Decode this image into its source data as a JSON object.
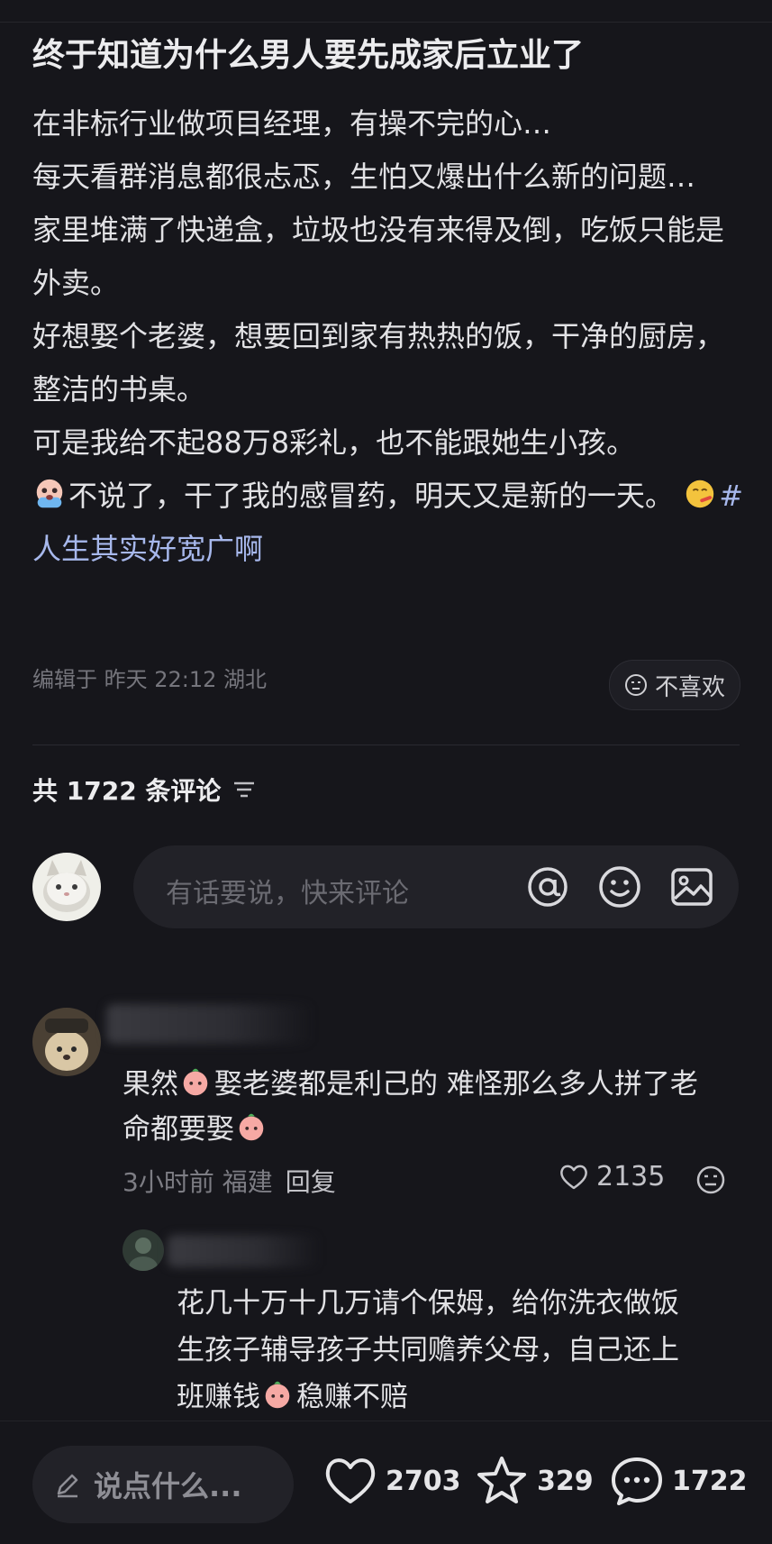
{
  "post": {
    "title": "终于知道为什么男人要先成家后立业了",
    "lines": [
      "在非标行业做项目经理，有操不完的心…",
      "每天看群消息都很忐忑，生怕又爆出什么新的问题…",
      "家里堆满了快递盒，垃圾也没有来得及倒，吃饭只能是外卖。",
      "好想娶个老婆，想要回到家有热热的饭，干净的厨房，整洁的书桌。",
      "可是我给不起88万8彩礼，也不能跟她生小孩。"
    ],
    "last_line_a": "不说了，干了我的感冒药，明天又是新的一天。",
    "hashtag": "#人生其实好宽广啊",
    "meta": "编辑于 昨天 22:12 湖北",
    "dislike_label": "不喜欢"
  },
  "comments_header": {
    "count_label": "共 1722 条评论"
  },
  "comment_input": {
    "placeholder": "有话要说，快来评论"
  },
  "comment1": {
    "text_a": "果然",
    "text_b": "娶老婆都是利己的 难怪那么多人拼了老",
    "text_c": "命都要娶",
    "time_location": "3小时前 福建",
    "reply_label": "回复",
    "likes": "2135"
  },
  "comment2": {
    "line1": "花几十万十几万请个保姆，给你洗衣做饭",
    "line2": "生孩子辅导孩子共同赡养父母，自己还上",
    "line3_a": "班赚钱",
    "line3_b": "稳赚不赔"
  },
  "bottom_bar": {
    "say_label": "说点什么...",
    "likes": "2703",
    "stars": "329",
    "comments": "1722"
  },
  "colors": {
    "background": "#16161b",
    "hashtag": "#a7b8ec",
    "muted": "#75757c"
  }
}
